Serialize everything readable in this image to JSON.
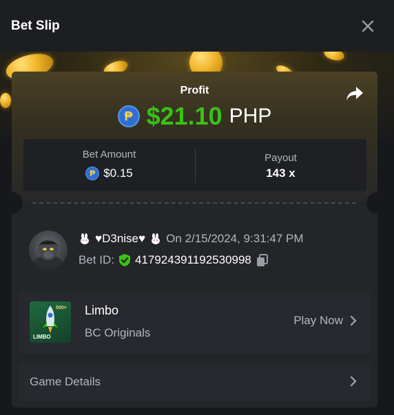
{
  "header": {
    "title": "Bet Slip"
  },
  "profit": {
    "label": "Profit",
    "currency_symbol": "₱",
    "value": "$21.10",
    "currency": "PHP",
    "color": "#3bc117"
  },
  "stats": {
    "bet_amount_label": "Bet Amount",
    "bet_amount_value": "$0.15",
    "payout_label": "Payout",
    "payout_value": "143 x"
  },
  "user": {
    "name": "♥D3nise♥",
    "date": "On 2/15/2024, 9:31:47 PM",
    "bet_id_label": "Bet ID:",
    "bet_id": "417924391192530998"
  },
  "game": {
    "name": "Limbo",
    "provider": "BC Originals",
    "play_label": "Play Now",
    "thumb_label": "LIMBO",
    "thumb_badge": "500×"
  },
  "details": {
    "label": "Game Details"
  },
  "icons": {
    "close": "close-icon",
    "share": "share-icon",
    "verified": "shield-check-icon",
    "copy": "copy-icon",
    "chevron": "chevron-right-icon"
  }
}
